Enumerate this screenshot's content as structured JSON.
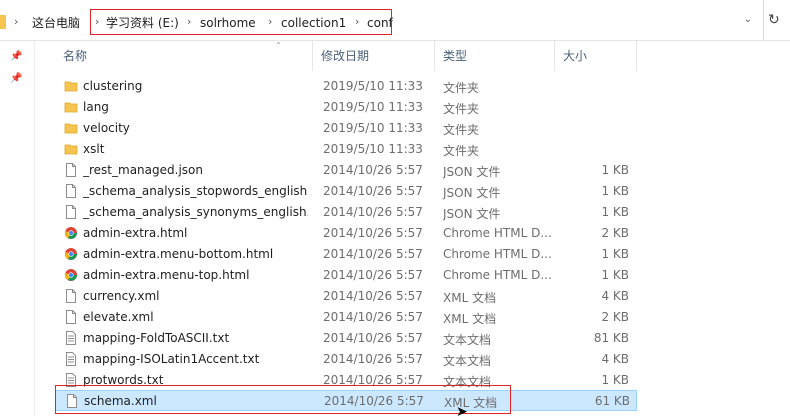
{
  "address": {
    "crumbs": [
      "这台电脑",
      "学习资料 (E:)",
      "solrhome",
      "collection1",
      "conf"
    ],
    "highlight_color": "#e02424"
  },
  "columns": {
    "name": "名称",
    "date": "修改日期",
    "type": "类型",
    "size": "大小"
  },
  "files": [
    {
      "name": "clustering",
      "date": "2019/5/10 11:33",
      "type": "文件夹",
      "size": "",
      "icon": "folder-icon"
    },
    {
      "name": "lang",
      "date": "2019/5/10 11:33",
      "type": "文件夹",
      "size": "",
      "icon": "folder-icon"
    },
    {
      "name": "velocity",
      "date": "2019/5/10 11:33",
      "type": "文件夹",
      "size": "",
      "icon": "folder-icon"
    },
    {
      "name": "xslt",
      "date": "2019/5/10 11:33",
      "type": "文件夹",
      "size": "",
      "icon": "folder-icon"
    },
    {
      "name": "_rest_managed.json",
      "date": "2014/10/26 5:57",
      "type": "JSON 文件",
      "size": "1 KB",
      "icon": "file-icon"
    },
    {
      "name": "_schema_analysis_stopwords_english....",
      "date": "2014/10/26 5:57",
      "type": "JSON 文件",
      "size": "1 KB",
      "icon": "file-icon"
    },
    {
      "name": "_schema_analysis_synonyms_english.j...",
      "date": "2014/10/26 5:57",
      "type": "JSON 文件",
      "size": "1 KB",
      "icon": "file-icon"
    },
    {
      "name": "admin-extra.html",
      "date": "2014/10/26 5:57",
      "type": "Chrome HTML D...",
      "size": "2 KB",
      "icon": "chrome-icon"
    },
    {
      "name": "admin-extra.menu-bottom.html",
      "date": "2014/10/26 5:57",
      "type": "Chrome HTML D...",
      "size": "1 KB",
      "icon": "chrome-icon"
    },
    {
      "name": "admin-extra.menu-top.html",
      "date": "2014/10/26 5:57",
      "type": "Chrome HTML D...",
      "size": "1 KB",
      "icon": "chrome-icon"
    },
    {
      "name": "currency.xml",
      "date": "2014/10/26 5:57",
      "type": "XML 文档",
      "size": "4 KB",
      "icon": "file-icon"
    },
    {
      "name": "elevate.xml",
      "date": "2014/10/26 5:57",
      "type": "XML 文档",
      "size": "2 KB",
      "icon": "file-icon"
    },
    {
      "name": "mapping-FoldToASCII.txt",
      "date": "2014/10/26 5:57",
      "type": "文本文档",
      "size": "81 KB",
      "icon": "text-file-icon"
    },
    {
      "name": "mapping-ISOLatin1Accent.txt",
      "date": "2014/10/26 5:57",
      "type": "文本文档",
      "size": "4 KB",
      "icon": "text-file-icon"
    },
    {
      "name": "protwords.txt",
      "date": "2014/10/26 5:57",
      "type": "文本文档",
      "size": "1 KB",
      "icon": "text-file-icon"
    },
    {
      "name": "schema.xml",
      "date": "2014/10/26 5:57",
      "type": "XML 文档",
      "size": "61 KB",
      "icon": "file-icon",
      "selected": true
    }
  ]
}
